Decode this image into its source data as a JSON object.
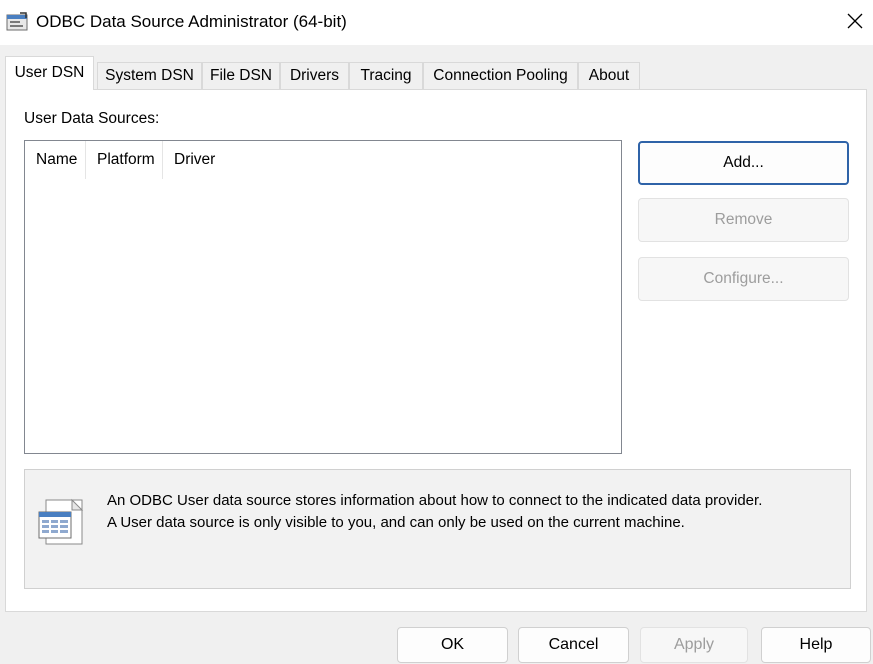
{
  "window": {
    "title": "ODBC Data Source Administrator (64-bit)",
    "icon": "odbc-admin-icon",
    "close_icon": "close-icon"
  },
  "tabs": [
    {
      "label": "User DSN",
      "active": true
    },
    {
      "label": "System DSN"
    },
    {
      "label": "File DSN"
    },
    {
      "label": "Drivers"
    },
    {
      "label": "Tracing"
    },
    {
      "label": "Connection Pooling"
    },
    {
      "label": "About"
    }
  ],
  "user_dsn": {
    "list_label": "User Data Sources:",
    "columns": [
      "Name",
      "Platform",
      "Driver"
    ],
    "rows": [],
    "buttons": {
      "add": "Add...",
      "remove": "Remove",
      "configure": "Configure..."
    },
    "info": {
      "icon": "datasource-icon",
      "line1": "An ODBC User data source stores information about how to connect to the indicated data provider.",
      "line2": "A User data source is only visible to you, and can only be used on the current machine."
    }
  },
  "footer": {
    "ok": "OK",
    "cancel": "Cancel",
    "apply": "Apply",
    "help": "Help"
  },
  "colors": {
    "accent_border": "#2f63a8",
    "disabled_text": "#9d9d9d"
  }
}
